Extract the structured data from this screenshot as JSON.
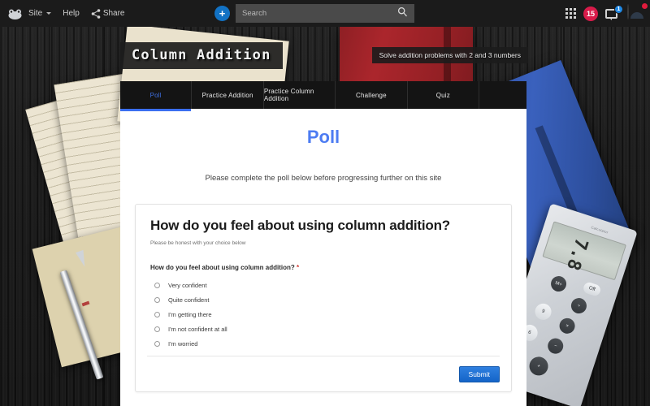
{
  "appbar": {
    "logo_icon": "frog-logo-icon",
    "site_label": "Site",
    "help_label": "Help",
    "share_label": "Share",
    "share_icon": "share-icon",
    "add_label": "+",
    "search": {
      "placeholder": "Search",
      "value": "",
      "icon": "search-icon"
    },
    "apps_icon": "grid-apps-icon",
    "notification_count": "15",
    "messages_icon": "message-icon",
    "messages_count": "1",
    "avatar_icon": "user-avatar",
    "avatar_alert": ""
  },
  "site": {
    "title": "Column Addition",
    "tagline": "Solve addition problems with 2 and 3 numbers"
  },
  "tabs": [
    {
      "label": "Poll",
      "active": true
    },
    {
      "label": "Practice Addition",
      "active": false
    },
    {
      "label": "Practice Column Addition",
      "active": false
    },
    {
      "label": "Challenge",
      "active": false
    },
    {
      "label": "Quiz",
      "active": false
    }
  ],
  "page": {
    "title": "Poll",
    "subtitle": "Please complete the poll below before progressing further on this site"
  },
  "poll": {
    "card_title": "How do you feel about using column addition?",
    "card_subtitle": "Please be honest with your choice below",
    "question_label": "How do you feel about using column addition?",
    "required_mark": "*",
    "options": [
      {
        "label": "Very confident",
        "selected": false
      },
      {
        "label": "Quite confident",
        "selected": false
      },
      {
        "label": "I'm getting there",
        "selected": false
      },
      {
        "label": "I'm not confident at all",
        "selected": false
      },
      {
        "label": "I'm worried",
        "selected": false
      }
    ],
    "submit_label": "Submit"
  },
  "desk": {
    "calculator_brand": "Calculator",
    "calculator_display": "7.8",
    "calculator_keys": [
      "Off",
      "M+",
      "÷",
      "9",
      "×",
      "6",
      "−",
      "+"
    ]
  },
  "colors": {
    "accent_blue": "#4d7cf2",
    "tab_active": "#3a6ef0",
    "submit_blue": "#1464c8",
    "badge_red": "#d81b4a",
    "badge_blue": "#1e88e5",
    "required_red": "#d23b34",
    "desk_dark": "#1c1c1c"
  }
}
